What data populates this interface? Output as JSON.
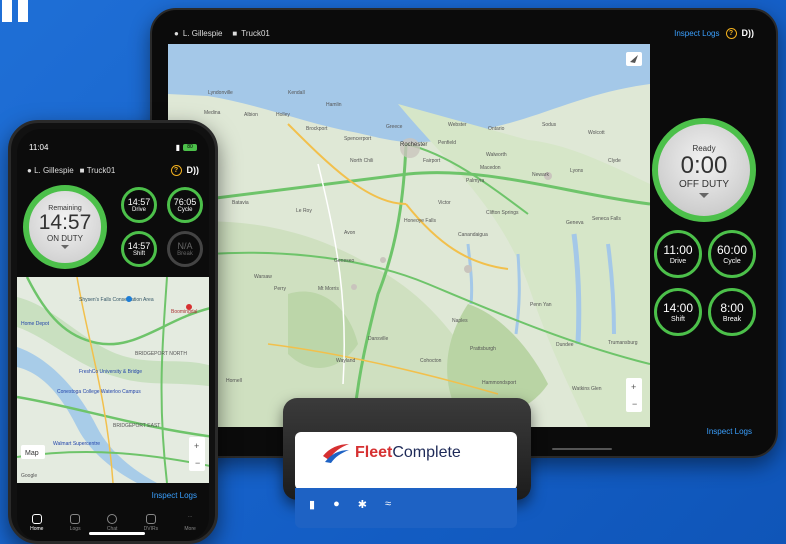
{
  "tablet": {
    "driver": "L. Gillespie",
    "truck": "Truck01",
    "inspect_top": "Inspect Logs",
    "help": "?",
    "status_icon": "D))",
    "ready": {
      "label": "Ready",
      "time": "0:00",
      "status": "OFF DUTY"
    },
    "timers": [
      {
        "value": "11:00",
        "label": "Drive"
      },
      {
        "value": "60:00",
        "label": "Cycle"
      },
      {
        "value": "14:00",
        "label": "Shift"
      },
      {
        "value": "8:00",
        "label": "Break"
      }
    ],
    "inspect_bottom": "Inspect Logs",
    "map_cities": [
      "Rochester",
      "Fairport",
      "North Chili",
      "Spencerport",
      "Brockport",
      "Greece",
      "Webster",
      "Penfield",
      "Ontario",
      "Walworth",
      "Macedon",
      "Palmyra",
      "Newark",
      "Sodus",
      "Wolcott",
      "Clyde",
      "Lyons",
      "Batavia",
      "Le Roy",
      "Avon",
      "Honeoye Falls",
      "Victor",
      "Clifton Springs",
      "Canandaigua",
      "Geneseo",
      "Mt Morris",
      "Warsaw",
      "Perry",
      "Dansville",
      "Naples",
      "Penn Yan",
      "Dundee",
      "Geneva",
      "Seneca Falls",
      "Trumansburg",
      "Watkins Glen",
      "Hammondsport",
      "Cohocton",
      "Prattsburgh",
      "Hornell",
      "Wayland",
      "Lyndonville",
      "Medina",
      "Albion",
      "Holley",
      "Kendall",
      "Hamlin"
    ]
  },
  "phone": {
    "time": "11:04",
    "battery": "80",
    "driver": "L. Gillespie",
    "truck": "Truck01",
    "remaining": {
      "label": "Remaining",
      "time": "14:57",
      "status": "ON DUTY"
    },
    "timers": [
      {
        "value": "14:57",
        "label": "Drive"
      },
      {
        "value": "76:05",
        "label": "Cycle"
      },
      {
        "value": "14:57",
        "label": "Shift"
      },
      {
        "value": "N/A",
        "label": "Break"
      }
    ],
    "map_labels": [
      "Shysen's Falls Conservation Area",
      "Boomingdal",
      "Home Depot",
      "BRIDGEPORT NORTH",
      "Conestoga College Waterloo Campus",
      "Walmart Supercentre",
      "BRIDGEPORT EAST",
      "FreshCo University & Bridge",
      "Google"
    ],
    "map_button": "Map",
    "inspect": "Inspect Logs",
    "nav": [
      "Home",
      "Logs",
      "Chat",
      "DVIRs",
      "More"
    ]
  },
  "device": {
    "brand_a": "Fleet",
    "brand_b": "Complete"
  },
  "colors": {
    "accent_green": "#4cc04a",
    "link_blue": "#3aa0ff",
    "bg_blue": "#1560c8"
  }
}
